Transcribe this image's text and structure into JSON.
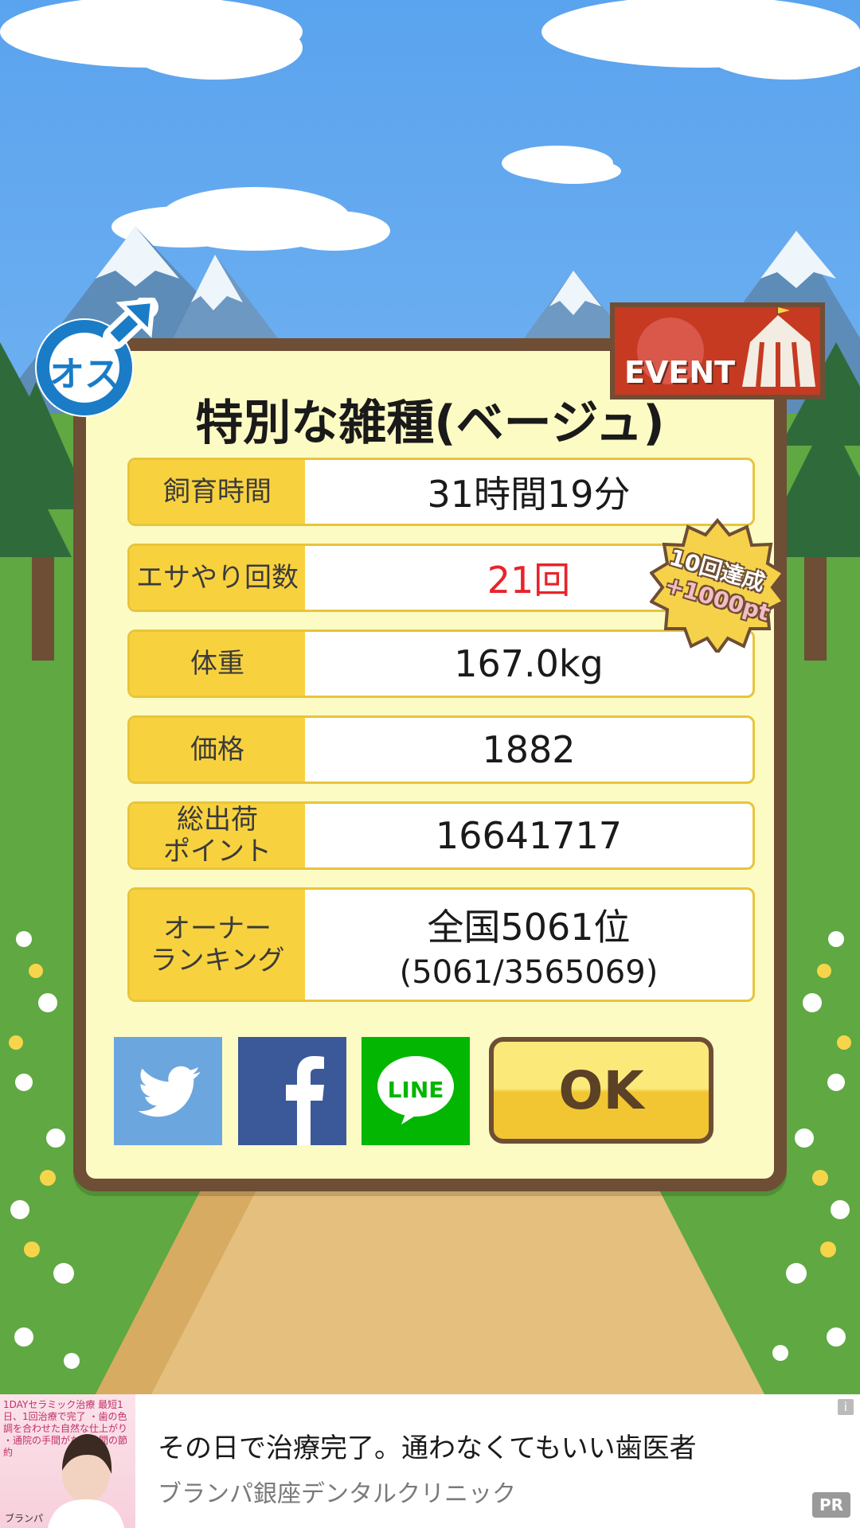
{
  "colors": {
    "sky": "#6fb1f2",
    "grass": "#5fa842",
    "path": "#e4bf7d",
    "panel_bg": "#fdfbc4",
    "panel_border": "#6e4e35",
    "label_bg": "#f8d23e",
    "highlight_red": "#e8232b",
    "twitter": "#6ba6de",
    "facebook": "#3b5998",
    "line": "#02b601"
  },
  "badge": {
    "gender_label": "オス",
    "gender_icon": "male-symbol-icon"
  },
  "event": {
    "label": "EVENT",
    "icon": "circus-tent-icon"
  },
  "achievement": {
    "line1": "10回達成",
    "line2": "+1000pt"
  },
  "dialog": {
    "title": "特別な雑種(ベージュ)",
    "rows": [
      {
        "label": "飼育時間",
        "value": "31時間19分"
      },
      {
        "label": "エサやり回数",
        "value": "21回",
        "highlight": true
      },
      {
        "label": "体重",
        "value": "167.0kg"
      },
      {
        "label": "価格",
        "value": "1882"
      },
      {
        "label_line1": "総出荷",
        "label_line2": "ポイント",
        "value": "16641717"
      },
      {
        "label_line1": "オーナー",
        "label_line2": "ランキング",
        "value": "全国5061位",
        "sub_value": "(5061/3565069)"
      }
    ],
    "share": {
      "twitter_icon": "twitter-bird-icon",
      "facebook_icon": "facebook-f-icon",
      "line_label": "LINE"
    },
    "ok_label": "OK"
  },
  "ad": {
    "image_caption": "1DAYセラミック治療 最短1日、1回治療で完了 ・歯の色調を合わせた自然な仕上がり ・通院の手間がなく時間の節約",
    "image_logo": "ブランパ",
    "headline": "その日で治療完了。通わなくてもいい歯医者",
    "advertiser": "ブランパ銀座デンタルクリニック",
    "badge": "PR",
    "info_icon": "i"
  }
}
